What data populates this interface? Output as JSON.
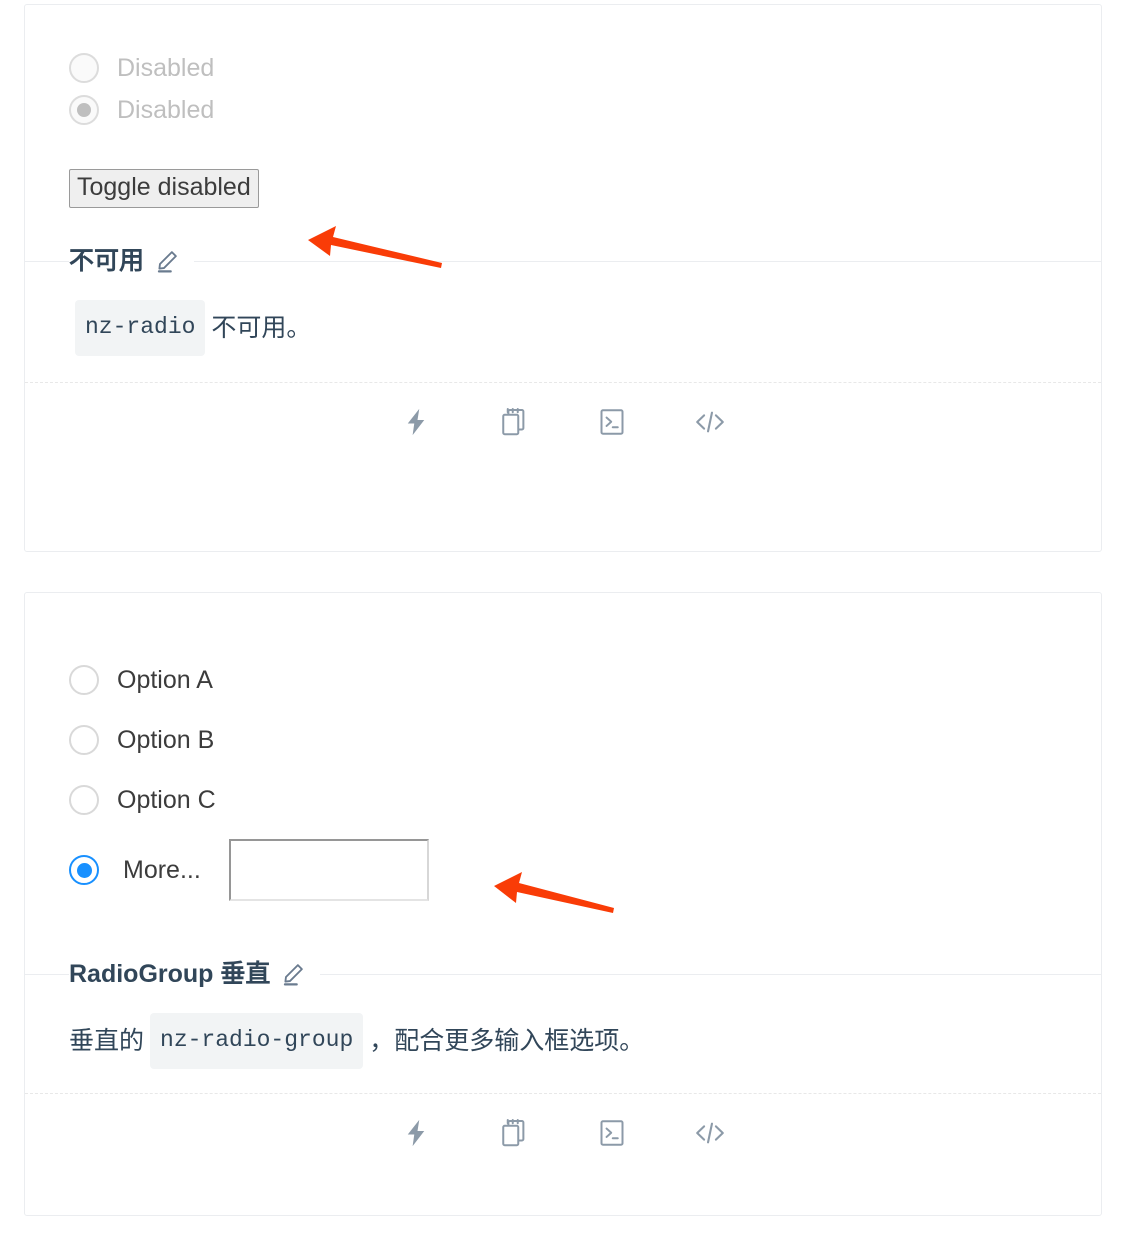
{
  "page": {
    "background": "#ffffff",
    "accent_color": "#1890ff",
    "annotation_color": "#f93c07",
    "card_border_color": "#ebedf0",
    "heading_color": "#314659"
  },
  "cards": [
    {
      "id": "disabled-demo",
      "demo": {
        "radios": [
          {
            "label": "Disabled",
            "checked": false,
            "disabled": true
          },
          {
            "label": "Disabled",
            "checked": true,
            "disabled": true
          }
        ],
        "toggle_button": {
          "label": "Toggle disabled"
        }
      },
      "meta": {
        "title": "不可用",
        "edit_icon": "edit-pencil-icon",
        "desc_code": "nz-radio",
        "desc_after": "不可用。"
      },
      "actions": [
        {
          "icon": "thunderbolt-icon",
          "name": "run-online-icon"
        },
        {
          "icon": "copy-icon",
          "name": "copy-code-icon"
        },
        {
          "icon": "terminal-icon",
          "name": "terminal-icon"
        },
        {
          "icon": "code-icon",
          "name": "show-code-icon"
        }
      ]
    },
    {
      "id": "radiogroup-vertical-demo",
      "demo": {
        "radios": [
          {
            "label": "Option A",
            "checked": false,
            "disabled": false
          },
          {
            "label": "Option B",
            "checked": false,
            "disabled": false
          },
          {
            "label": "Option C",
            "checked": false,
            "disabled": false
          },
          {
            "label": "More...",
            "checked": true,
            "disabled": false
          }
        ],
        "more_input": {
          "value": "",
          "placeholder": ""
        }
      },
      "meta": {
        "title": "RadioGroup 垂直",
        "edit_icon": "edit-pencil-icon",
        "desc_before": "垂直的",
        "desc_code": "nz-radio-group",
        "desc_after": "，配合更多输入框选项。"
      },
      "actions": [
        {
          "icon": "thunderbolt-icon",
          "name": "run-online-icon"
        },
        {
          "icon": "copy-icon",
          "name": "copy-code-icon"
        },
        {
          "icon": "terminal-icon",
          "name": "terminal-icon"
        },
        {
          "icon": "code-icon",
          "name": "show-code-icon"
        }
      ]
    }
  ],
  "annotations": [
    {
      "name": "arrow-to-toggle-button",
      "direction": "left"
    },
    {
      "name": "arrow-to-more-input",
      "direction": "left"
    }
  ]
}
